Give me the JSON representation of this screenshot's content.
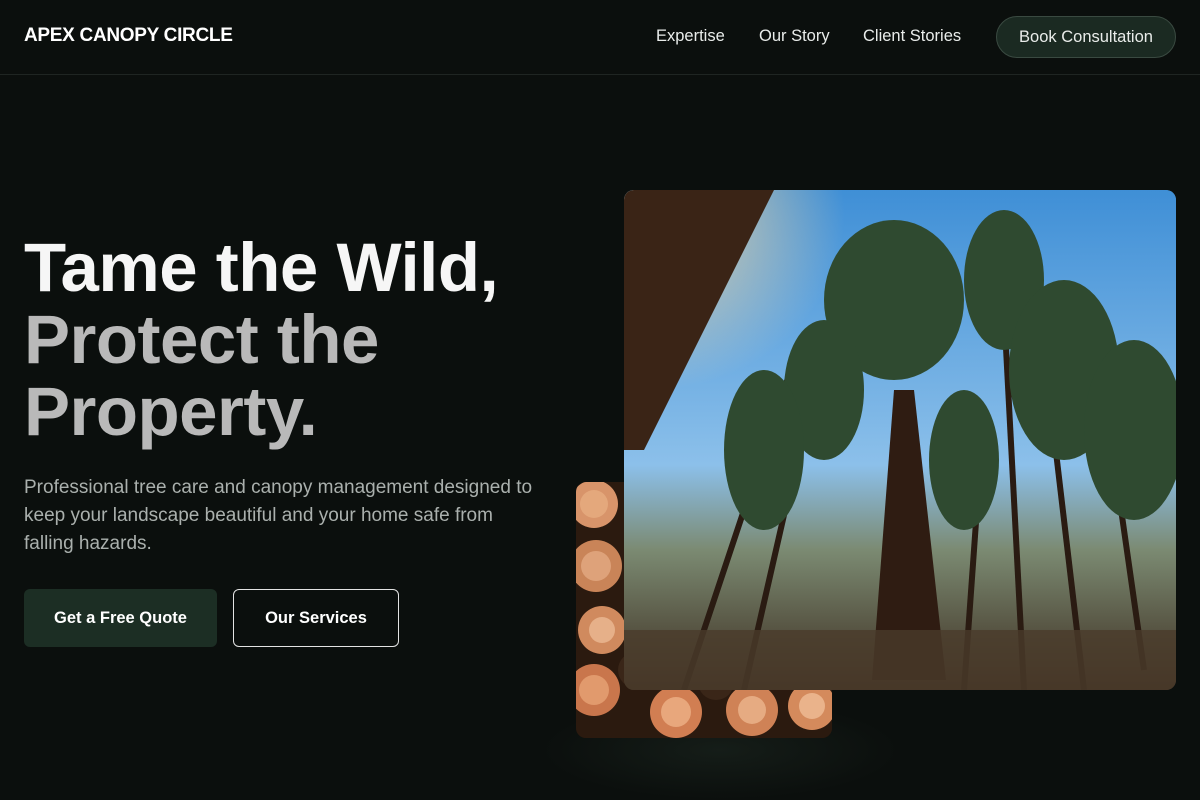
{
  "header": {
    "brand": "APEX CANOPY CIRCLE",
    "nav": [
      "Expertise",
      "Our Story",
      "Client Stories"
    ],
    "cta": "Book Consultation"
  },
  "hero": {
    "headline_line1": "Tame the Wild,",
    "headline_line2": "Protect the",
    "headline_line3": "Property.",
    "subtext": "Professional tree care and canopy management designed to keep your landscape beautiful and your home safe from falling hazards.",
    "primary_button": "Get a Free Quote",
    "secondary_button": "Our Services"
  },
  "images": {
    "main_image_icon": "forest-canopy-photo",
    "secondary_image_icon": "stacked-logs-photo"
  },
  "colors": {
    "background": "#0b0f0d",
    "accent_green": "#1c2e24",
    "text_primary": "#f6f6f6",
    "text_muted": "#aab0ad"
  }
}
